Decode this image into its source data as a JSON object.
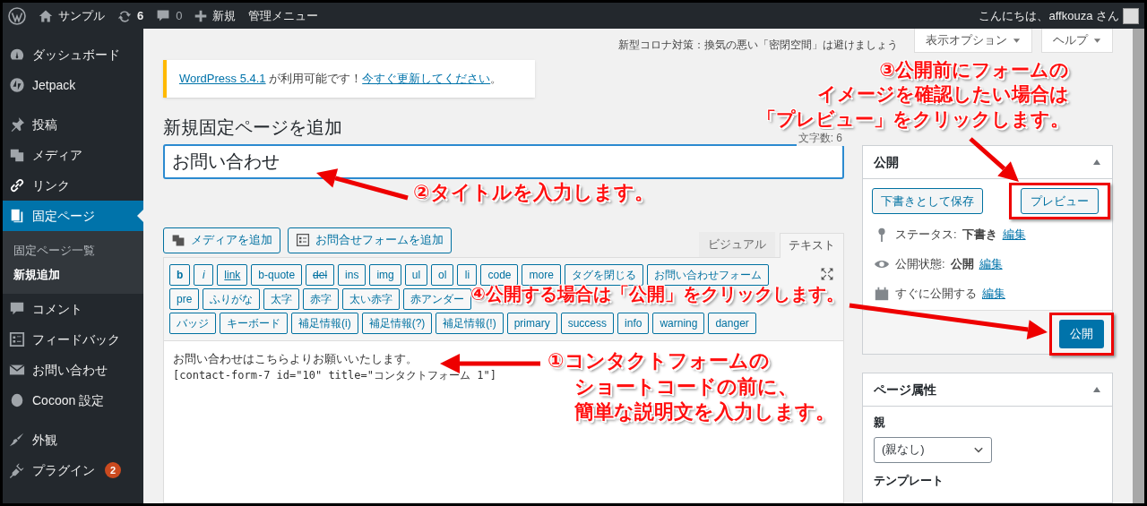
{
  "admin_bar": {
    "items": [
      {
        "kind": "logo"
      },
      {
        "kind": "home",
        "label": "サンプル"
      },
      {
        "kind": "updates",
        "label": "6"
      },
      {
        "kind": "comments",
        "label": "0"
      },
      {
        "kind": "new",
        "label": "新規"
      },
      {
        "kind": "text",
        "label": "管理メニュー"
      }
    ],
    "greeting": "こんにちは、affkouza さん"
  },
  "sidebar": {
    "groups": [
      [
        {
          "label": "ダッシュボード",
          "selected": false
        },
        {
          "label": "Jetpack",
          "selected": false
        }
      ],
      [
        {
          "label": "投稿",
          "selected": false
        },
        {
          "label": "メディア",
          "selected": false
        },
        {
          "label": "リンク",
          "selected": false
        },
        {
          "label": "固定ページ",
          "selected": true,
          "children": [
            {
              "label": "固定ページ一覧",
              "selected": false
            },
            {
              "label": "新規追加",
              "selected": true
            }
          ]
        },
        {
          "label": "コメント",
          "selected": false
        },
        {
          "label": "フィードバック",
          "selected": false
        },
        {
          "label": "お問い合わせ",
          "selected": false
        },
        {
          "label": "Cocoon 設定",
          "selected": false
        }
      ],
      [
        {
          "label": "外観",
          "selected": false
        },
        {
          "label": "プラグイン",
          "selected": false,
          "badge": "2"
        }
      ]
    ]
  },
  "header_notice": "新型コロナ対策：換気の悪い「密閉空間」は避けましょう",
  "screen_tabs": [
    "表示オプション",
    "ヘルプ"
  ],
  "update_notice": [
    {
      "text": "WordPress 5.4.1",
      "link": true
    },
    {
      "text": " が利用可能です！",
      "link": false
    },
    {
      "text": "今すぐ更新してください",
      "link": true
    },
    {
      "text": "。",
      "link": false
    }
  ],
  "heading": "新規固定ページを追加",
  "word_count": "文字数: 6",
  "title_field": {
    "value": "お問い合わせ"
  },
  "editor": {
    "media_buttons": [
      "メディアを追加",
      "お問合せフォームを追加"
    ],
    "tabs": [
      {
        "label": "ビジュアル",
        "selected": false
      },
      {
        "label": "テキスト",
        "selected": true
      }
    ],
    "toolbar_rows": [
      [
        {
          "label": "b",
          "kind": "bold"
        },
        {
          "label": "i",
          "kind": "italic"
        },
        {
          "label": "link",
          "kind": "link"
        },
        {
          "label": "b-quote",
          "kind": "plain"
        },
        {
          "label": "del",
          "kind": "strike"
        },
        {
          "label": "ins",
          "kind": "plain"
        },
        {
          "label": "img",
          "kind": "plain"
        },
        {
          "label": "ul",
          "kind": "plain"
        },
        {
          "label": "ol",
          "kind": "plain"
        },
        {
          "label": "li",
          "kind": "plain"
        },
        {
          "label": "code",
          "kind": "plain"
        },
        {
          "label": "more",
          "kind": "plain"
        },
        {
          "label": "タグを閉じる",
          "kind": "plain"
        },
        {
          "label": "お問い合わせフォーム",
          "kind": "plain"
        }
      ],
      [
        {
          "label": "pre",
          "kind": "plain"
        },
        {
          "label": "ふりがな",
          "kind": "plain"
        },
        {
          "label": "太字",
          "kind": "plain"
        },
        {
          "label": "赤字",
          "kind": "plain"
        },
        {
          "label": "太い赤字",
          "kind": "plain"
        },
        {
          "label": "赤アンダー",
          "kind": "plain"
        }
      ],
      [
        {
          "label": "バッジ",
          "kind": "plain"
        },
        {
          "label": "キーボード",
          "kind": "plain"
        },
        {
          "label": "補足情報(i)",
          "kind": "plain"
        },
        {
          "label": "補足情報(?)",
          "kind": "plain"
        },
        {
          "label": "補足情報(!)",
          "kind": "plain"
        },
        {
          "label": "primary",
          "kind": "plain"
        },
        {
          "label": "success",
          "kind": "plain"
        },
        {
          "label": "info",
          "kind": "plain"
        },
        {
          "label": "warning",
          "kind": "plain"
        },
        {
          "label": "danger",
          "kind": "plain"
        }
      ]
    ],
    "content": [
      "お問い合わせはこちらよりお願いいたします。",
      "[contact-form-7 id=\"10\" title=\"コンタクトフォーム 1\"]"
    ]
  },
  "publish_box": {
    "title": "公開",
    "save_draft": "下書きとして保存",
    "preview": "プレビュー",
    "rows": [
      {
        "kind": "status",
        "label": "ステータス:",
        "value": "下書き",
        "link": "編集"
      },
      {
        "kind": "visibility",
        "label": "公開状態:",
        "value": "公開",
        "link": "編集"
      },
      {
        "kind": "schedule",
        "label": "すぐに公開する",
        "link": "編集"
      }
    ],
    "publish": "公開"
  },
  "page_attributes": {
    "title": "ページ属性",
    "parent_label": "親",
    "parent_select": "(親なし)",
    "template_label": "テンプレート"
  },
  "annotations": [
    {
      "lines": [
        "②タイトルを入力します。"
      ]
    },
    {
      "lines": [
        "③公開前にフォームの",
        "イメージを確認したい場合は",
        "「プレビュー」をクリックします。"
      ]
    },
    {
      "lines": [
        "④公開する場合は「公開」をクリックします。"
      ]
    },
    {
      "lines": [
        "①コンタクトフォームの",
        "ショートコードの前に、",
        "簡単な説明文を入力します。"
      ]
    }
  ]
}
